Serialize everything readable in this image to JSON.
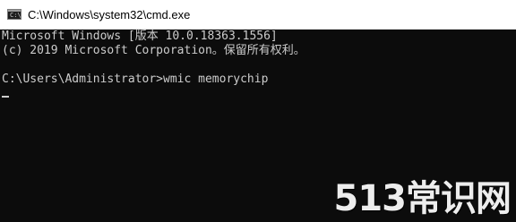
{
  "window": {
    "title": "C:\\Windows\\system32\\cmd.exe",
    "icon": "cmd-console-icon"
  },
  "console": {
    "lines": [
      "Microsoft Windows [版本 10.0.18363.1556]",
      "(c) 2019 Microsoft Corporation。保留所有权利。",
      "",
      "C:\\Users\\Administrator>wmic memorychip"
    ],
    "colors": {
      "background": "#0c0c0c",
      "text": "#cccccc"
    }
  },
  "watermark": {
    "text": "513常识网"
  }
}
